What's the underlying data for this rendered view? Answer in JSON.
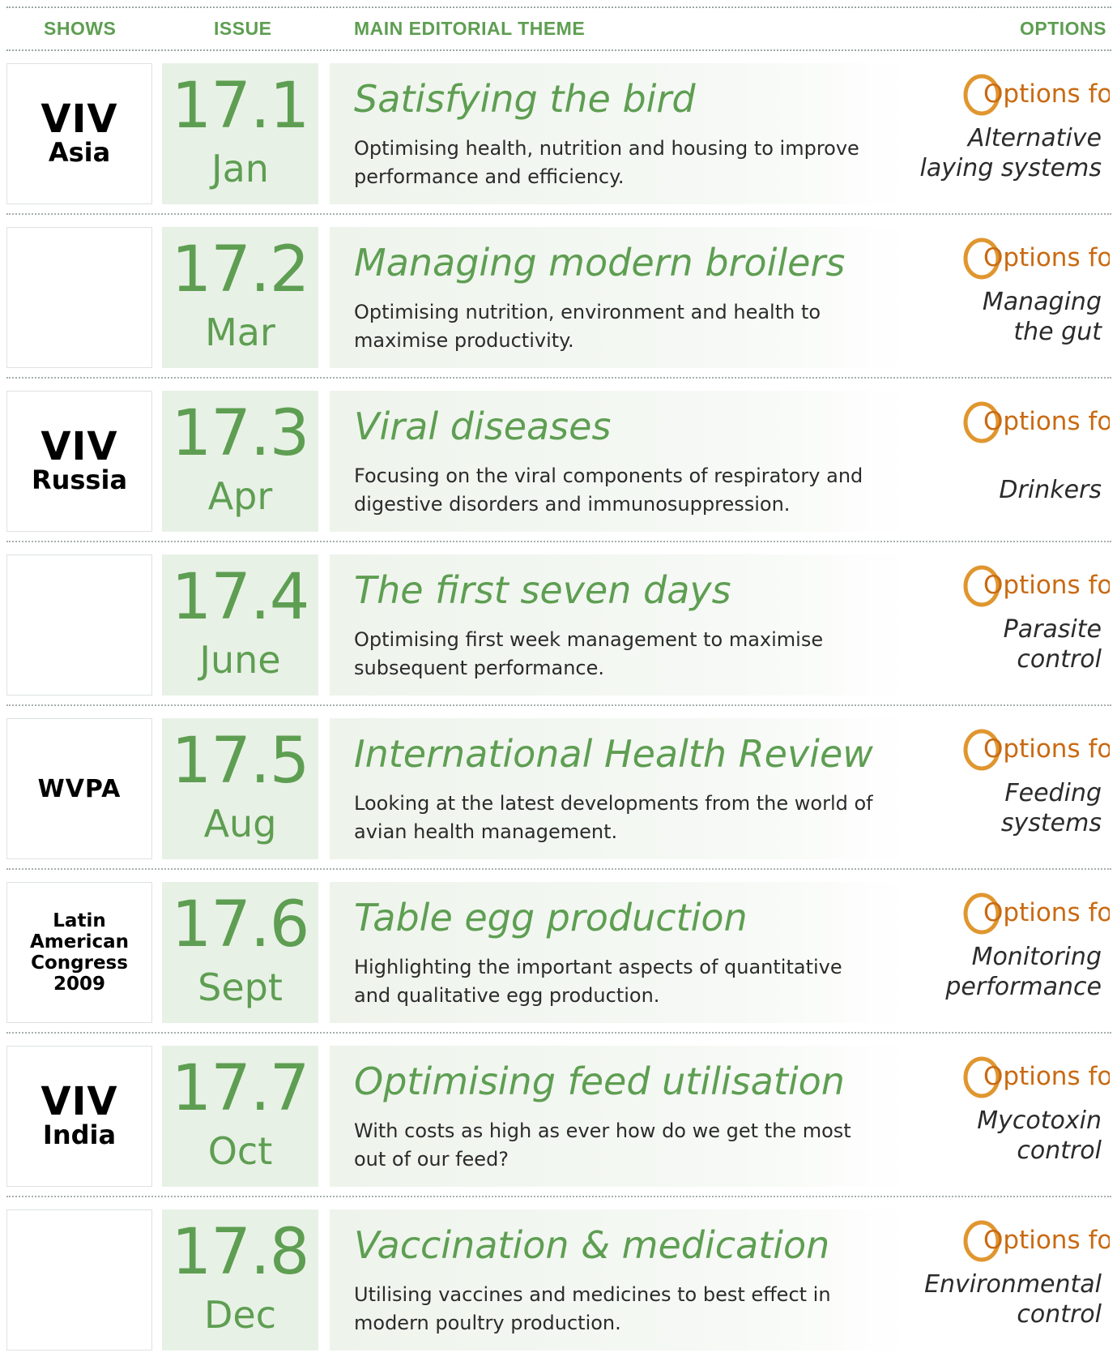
{
  "header": {
    "shows": "SHOWS",
    "issue": "ISSUE",
    "theme": "MAIN EDITORIAL THEME",
    "options": "OPTIONS"
  },
  "logo": {
    "text": "Options for",
    "o_color": "#e0962f",
    "text_color": "#c96a12"
  },
  "rows": [
    {
      "show": [
        "VIV",
        "Asia"
      ],
      "show_style": "big",
      "issue": "17.1",
      "month": "Jan",
      "title": "Satisfying the bird",
      "desc": "Optimising health, nutrition and housing to improve performance and efficiency.",
      "option": [
        "Alternative",
        "laying systems"
      ]
    },
    {
      "show": [],
      "show_style": "none",
      "issue": "17.2",
      "month": "Mar",
      "title": "Managing modern broilers",
      "desc": "Optimising nutrition, environment and health to maximise productivity.",
      "option": [
        "Managing",
        "the gut"
      ]
    },
    {
      "show": [
        "VIV",
        "Russia"
      ],
      "show_style": "big",
      "issue": "17.3",
      "month": "Apr",
      "title": "Viral diseases",
      "desc": "Focusing on the viral components of respiratory and digestive disorders and immunosuppression.",
      "option": [
        "Drinkers"
      ]
    },
    {
      "show": [],
      "show_style": "none",
      "issue": "17.4",
      "month": "June",
      "title": "The first seven days",
      "desc": "Optimising first week management to maximise subsequent performance.",
      "option": [
        "Parasite",
        "control"
      ]
    },
    {
      "show": [
        "WVPA"
      ],
      "show_style": "single",
      "issue": "17.5",
      "month": "Aug",
      "title": "International Health Review",
      "desc": "Looking at the latest developments from the world of avian health management.",
      "option": [
        "Feeding",
        "systems"
      ]
    },
    {
      "show": [
        "Latin",
        "American",
        "Congress",
        "2009"
      ],
      "show_style": "small",
      "issue": "17.6",
      "month": "Sept",
      "title": "Table egg production",
      "desc": "Highlighting the important aspects of quantitative and qualitative egg production.",
      "option": [
        "Monitoring",
        "performance"
      ]
    },
    {
      "show": [
        "VIV",
        "India"
      ],
      "show_style": "big",
      "issue": "17.7",
      "month": "Oct",
      "title": "Optimising feed utilisation",
      "desc": "With costs as high as ever how do we get the most out of our feed?",
      "option": [
        "Mycotoxin",
        "control"
      ]
    },
    {
      "show": [],
      "show_style": "none",
      "issue": "17.8",
      "month": "Dec",
      "title": "Vaccination & medication",
      "desc": "Utilising vaccines and medicines to best effect in modern poultry production.",
      "option": [
        "Environmental",
        "control"
      ]
    }
  ]
}
